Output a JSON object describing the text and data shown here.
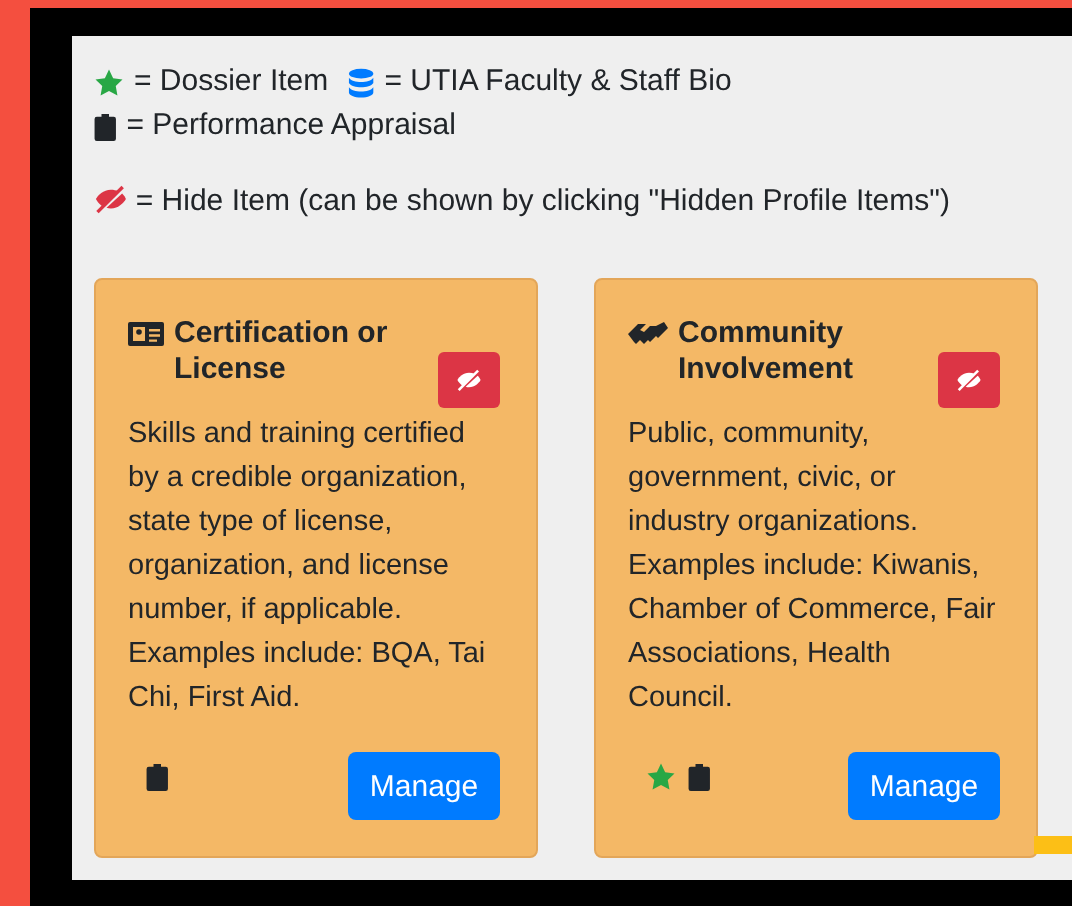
{
  "legend": [
    {
      "kind": "star",
      "label": "= Dossier Item"
    },
    {
      "kind": "database",
      "label": "= UTIA Faculty & Staff Bio"
    },
    {
      "kind": "clipboard",
      "label": "= Performance Appraisal"
    }
  ],
  "hide_legend": {
    "label": "= Hide Item (can be shown by clicking \"Hidden Profile Items\")"
  },
  "cards": [
    {
      "kind": "id-card",
      "title": "Certification or License",
      "description": "Skills and training certified by a credible organization, state type of license, organization, and license number, if applicable. Examples include: BQA, Tai Chi, First Aid.",
      "badges": [
        {
          "kind": "clipboard"
        }
      ],
      "button": "Manage"
    },
    {
      "kind": "handshake",
      "title": "Community Involvement",
      "description": "Public, community, government, civic, or industry organizations. Examples include: Kiwanis, Chamber of Commerce, Fair Associations, Health Council.",
      "badges": [
        {
          "kind": "star"
        },
        {
          "kind": "clipboard"
        }
      ],
      "button": "Manage"
    }
  ]
}
